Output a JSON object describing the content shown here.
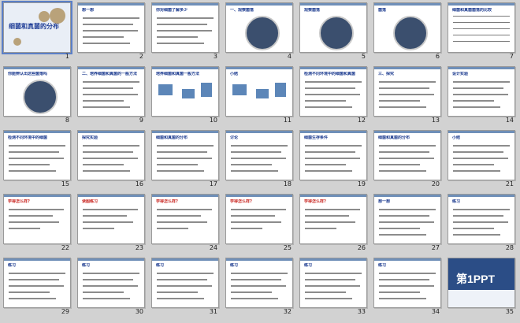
{
  "slide_sorter": {
    "title_slide": "细菌和真菌的分布",
    "slides": [
      {
        "n": "1",
        "title": "细菌和真菌的分布",
        "kind": "cover"
      },
      {
        "n": "2",
        "title": "想一想",
        "kind": "text"
      },
      {
        "n": "3",
        "title": "你对细菌了解多少",
        "kind": "text"
      },
      {
        "n": "4",
        "title": "一、观察菌落",
        "kind": "dish"
      },
      {
        "n": "5",
        "title": "观察菌落",
        "kind": "dish"
      },
      {
        "n": "6",
        "title": "菌落",
        "kind": "dish"
      },
      {
        "n": "7",
        "title": "细菌和真菌菌落的比较",
        "kind": "table"
      },
      {
        "n": "8",
        "title": "你能辨认出这些菌落吗",
        "kind": "dish"
      },
      {
        "n": "9",
        "title": "二、培养细菌和真菌的一般方法",
        "kind": "text"
      },
      {
        "n": "10",
        "title": "培养细菌和真菌一般方法",
        "kind": "diagram"
      },
      {
        "n": "11",
        "title": "小结",
        "kind": "diagram"
      },
      {
        "n": "12",
        "title": "检测不同环境中的细菌和真菌",
        "kind": "text"
      },
      {
        "n": "13",
        "title": "三、探究",
        "kind": "text"
      },
      {
        "n": "14",
        "title": "设计实验",
        "kind": "text"
      },
      {
        "n": "15",
        "title": "检测不同环境中的细菌",
        "kind": "text"
      },
      {
        "n": "16",
        "title": "探究实验",
        "kind": "text"
      },
      {
        "n": "17",
        "title": "细菌和真菌的分布",
        "kind": "text"
      },
      {
        "n": "18",
        "title": "讨论",
        "kind": "text"
      },
      {
        "n": "19",
        "title": "细菌生存条件",
        "kind": "text"
      },
      {
        "n": "20",
        "title": "细菌和真菌的分布",
        "kind": "text"
      },
      {
        "n": "21",
        "title": "小结",
        "kind": "text"
      },
      {
        "n": "22",
        "title": "学得怎么样?",
        "kind": "quiz"
      },
      {
        "n": "23",
        "title": "读图练习",
        "kind": "quiz"
      },
      {
        "n": "24",
        "title": "学得怎么样?",
        "kind": "quiz"
      },
      {
        "n": "25",
        "title": "学得怎么样?",
        "kind": "quiz"
      },
      {
        "n": "26",
        "title": "学得怎么样?",
        "kind": "quiz"
      },
      {
        "n": "27",
        "title": "想一想",
        "kind": "text"
      },
      {
        "n": "28",
        "title": "练习",
        "kind": "text"
      },
      {
        "n": "29",
        "title": "练习",
        "kind": "text"
      },
      {
        "n": "30",
        "title": "练习",
        "kind": "text"
      },
      {
        "n": "31",
        "title": "练习",
        "kind": "text"
      },
      {
        "n": "32",
        "title": "练习",
        "kind": "text"
      },
      {
        "n": "33",
        "title": "练习",
        "kind": "text"
      },
      {
        "n": "34",
        "title": "练习",
        "kind": "text"
      },
      {
        "n": "35",
        "title": "第1PPT",
        "kind": "ad"
      }
    ]
  },
  "colors": {
    "accent": "#1b3a8f",
    "quiz": "#c8231e",
    "background": "#d2d2d2"
  }
}
